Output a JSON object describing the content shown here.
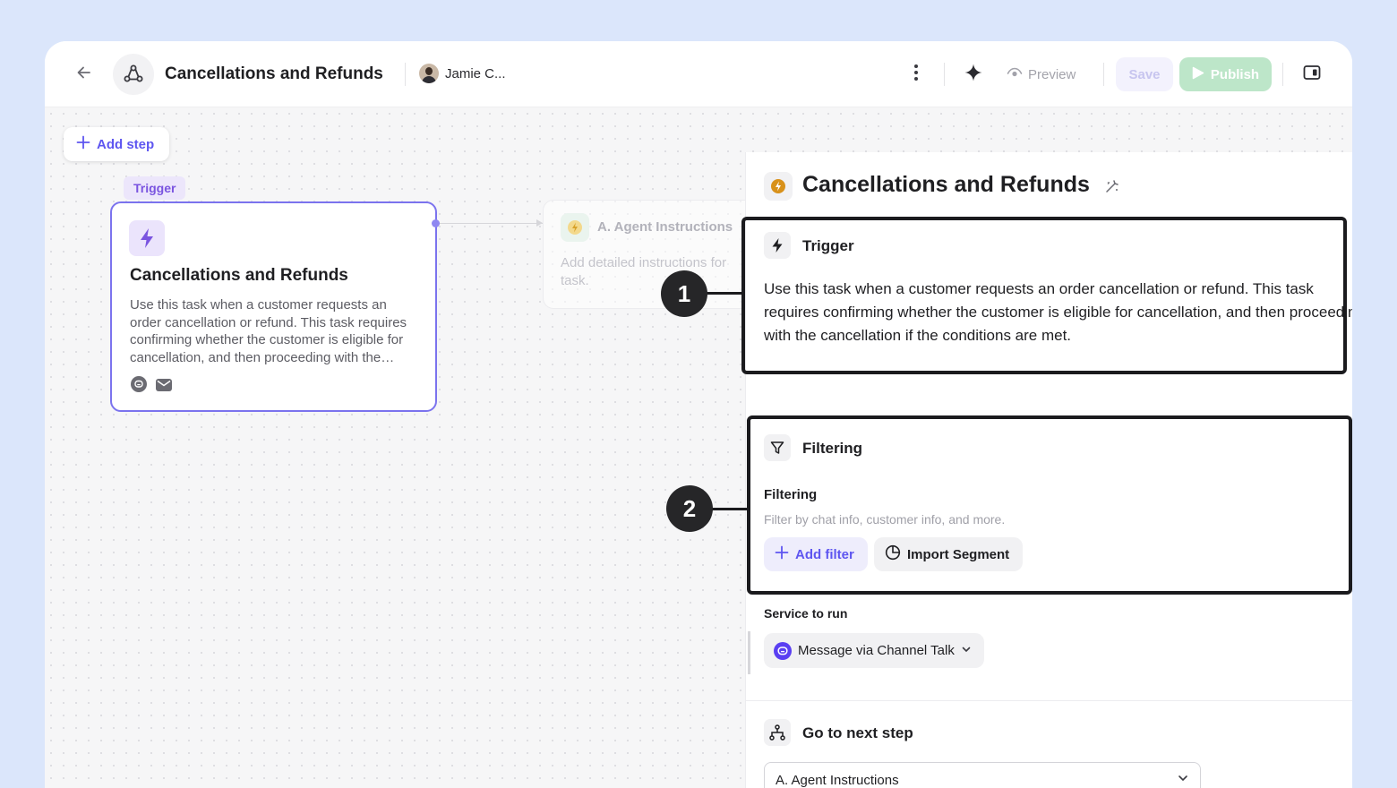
{
  "header": {
    "title": "Cancellations and Refunds",
    "user_name": "Jamie C...",
    "preview_label": "Preview",
    "save_label": "Save",
    "publish_label": "Publish"
  },
  "canvas": {
    "add_step_label": "Add step",
    "trigger_tag": "Trigger",
    "trigger_node": {
      "title": "Cancellations and Refunds",
      "description": "Use this task when a customer requests an order cancellation or refund. This task requires confirming whether the customer is eligible for cancellation, and then proceeding with the cancellation if the conditions are met."
    },
    "agent_node": {
      "title": "A. Agent Instructions",
      "description": "Add detailed instructions for task."
    }
  },
  "panel": {
    "title": "Cancellations and Refunds",
    "trigger": {
      "title": "Trigger",
      "text": "Use this task when a customer requests an order cancellation or refund. This task requires confirming whether the customer is eligible for cancellation, and then proceeding with the cancellation if the conditions are met."
    },
    "filtering": {
      "section_title": "Filtering",
      "label": "Filtering",
      "hint": "Filter by chat info, customer info, and more.",
      "add_filter_label": "Add filter",
      "import_segment_label": "Import Segment"
    },
    "service": {
      "label": "Service to run",
      "selected": "Message via Channel Talk"
    },
    "next_step": {
      "title": "Go to next step",
      "selected": "A. Agent Instructions"
    }
  },
  "annotations": {
    "callout_1": "1",
    "callout_2": "2"
  },
  "icons": [
    "back-arrow-icon",
    "app-logo-icon",
    "more-vertical-icon",
    "sparkle-icon",
    "eye-icon",
    "play-icon",
    "sidebar-toggle-icon",
    "plus-icon",
    "lightning-icon",
    "channel-talk-icon",
    "mail-icon",
    "agent-icon",
    "rename-icon",
    "filter-icon",
    "pie-chart-icon",
    "chevron-down-icon",
    "branch-icon"
  ],
  "colors": {
    "accent": "#5e56f0",
    "trigger_purple": "#7a54e0",
    "publish_green": "#bde6c9",
    "background": "#dbe6fb"
  }
}
